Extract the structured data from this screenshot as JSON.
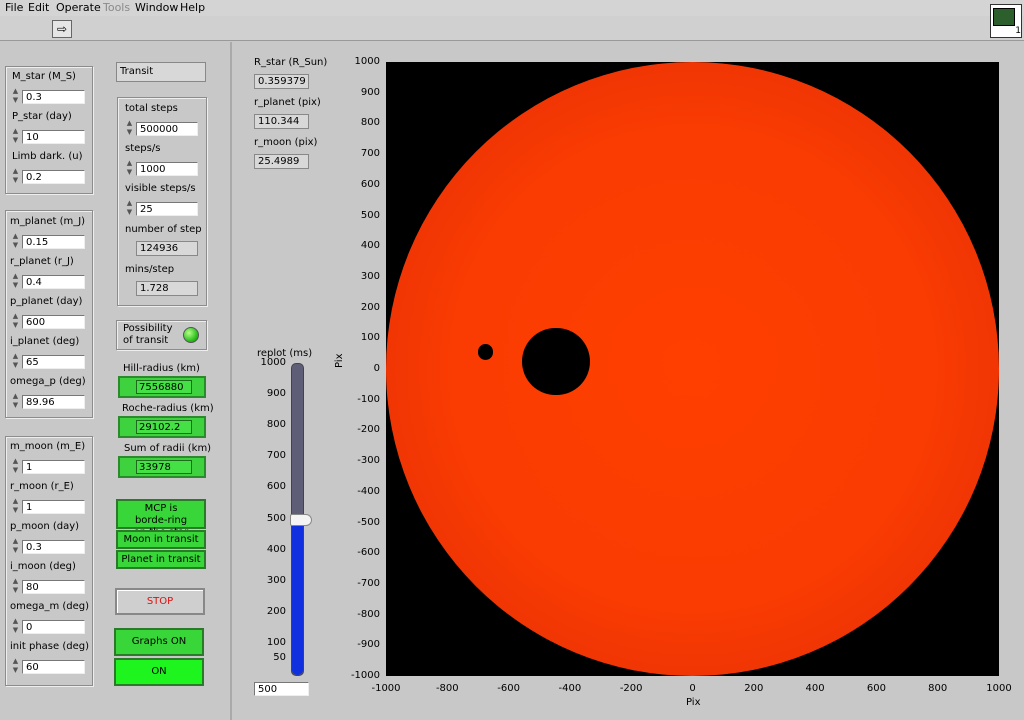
{
  "menu": [
    "File",
    "Edit",
    "Operate",
    "Tools",
    "Window",
    "Help"
  ],
  "vi_icon_label": "1",
  "star": {
    "m_star_label": "M_star (M_S)",
    "m_star": "0.3",
    "p_star_label": "P_star (day)",
    "p_star": "10",
    "limb_label": "Limb dark. (u)",
    "limb": "0.2"
  },
  "planet": {
    "m_label": "m_planet (m_J)",
    "m": "0.15",
    "r_label": "r_planet (r_J)",
    "r": "0.4",
    "p_label": "p_planet (day)",
    "p": "600",
    "i_label": "i_planet (deg)",
    "i": "65",
    "omega_label": "omega_p (deg)",
    "omega": "89.96"
  },
  "moon": {
    "m_label": "m_moon (m_E)",
    "m": "1",
    "r_label": "r_moon (r_E)",
    "r": "1",
    "p_label": "p_moon (day)",
    "p": "0.3",
    "i_label": "i_moon (deg)",
    "i": "80",
    "omega_label": "omega_m (deg)",
    "omega": "0",
    "phase_label": "init phase (deg)",
    "phase": "60"
  },
  "mode": "Transit",
  "steps": {
    "total_label": "total steps",
    "total": "500000",
    "per_s_label": "steps/s",
    "per_s": "1000",
    "visible_label": "visible steps/s",
    "visible": "25",
    "number_label": "number of step",
    "number": "124936",
    "mins_label": "mins/step",
    "mins": "1.728"
  },
  "possibility_label": "Possibility of transit",
  "hill_label": "Hill-radius (km)",
  "hill": "7556880",
  "roche_label": "Roche-radius (km)",
  "roche": "29102.2",
  "sum_label": "Sum of radii (km)",
  "sum": "33978",
  "status": {
    "mcp": "MCP is borde-ring on the star",
    "moon": "Moon in transit",
    "planet": "Planet in transit"
  },
  "stop_label": "STOP",
  "graphs_label": "Graphs ON",
  "on_label": "ON",
  "r_star_label": "R_star (R_Sun)",
  "r_star": "0.359379",
  "r_planet_pix_label": "r_planet (pix)",
  "r_planet_pix": "110.344",
  "r_moon_pix_label": "r_moon (pix)",
  "r_moon_pix": "25.4989",
  "replot": {
    "label": "replot (ms)",
    "value": 500,
    "value_text": "500",
    "max": 1000,
    "ticks": [
      "1000",
      "900",
      "800",
      "700",
      "600",
      "500",
      "400",
      "300",
      "200",
      "100",
      "50",
      "0"
    ]
  },
  "plot": {
    "xlabel": "Pix",
    "ylabel": "Pix",
    "yticks": [
      "1000",
      "900",
      "800",
      "700",
      "600",
      "500",
      "400",
      "300",
      "200",
      "100",
      "0",
      "-100",
      "-200",
      "-300",
      "-400",
      "-500",
      "-600",
      "-700",
      "-800",
      "-900",
      "-1000"
    ],
    "xticks": [
      "-1000",
      "-800",
      "-600",
      "-400",
      "-200",
      "0",
      "200",
      "400",
      "600",
      "800",
      "1000"
    ],
    "star_color": "#ff3f00",
    "planet": {
      "x": -445,
      "y": 25,
      "r": 110
    },
    "moon": {
      "x": -675,
      "y": 55,
      "r": 25
    }
  }
}
